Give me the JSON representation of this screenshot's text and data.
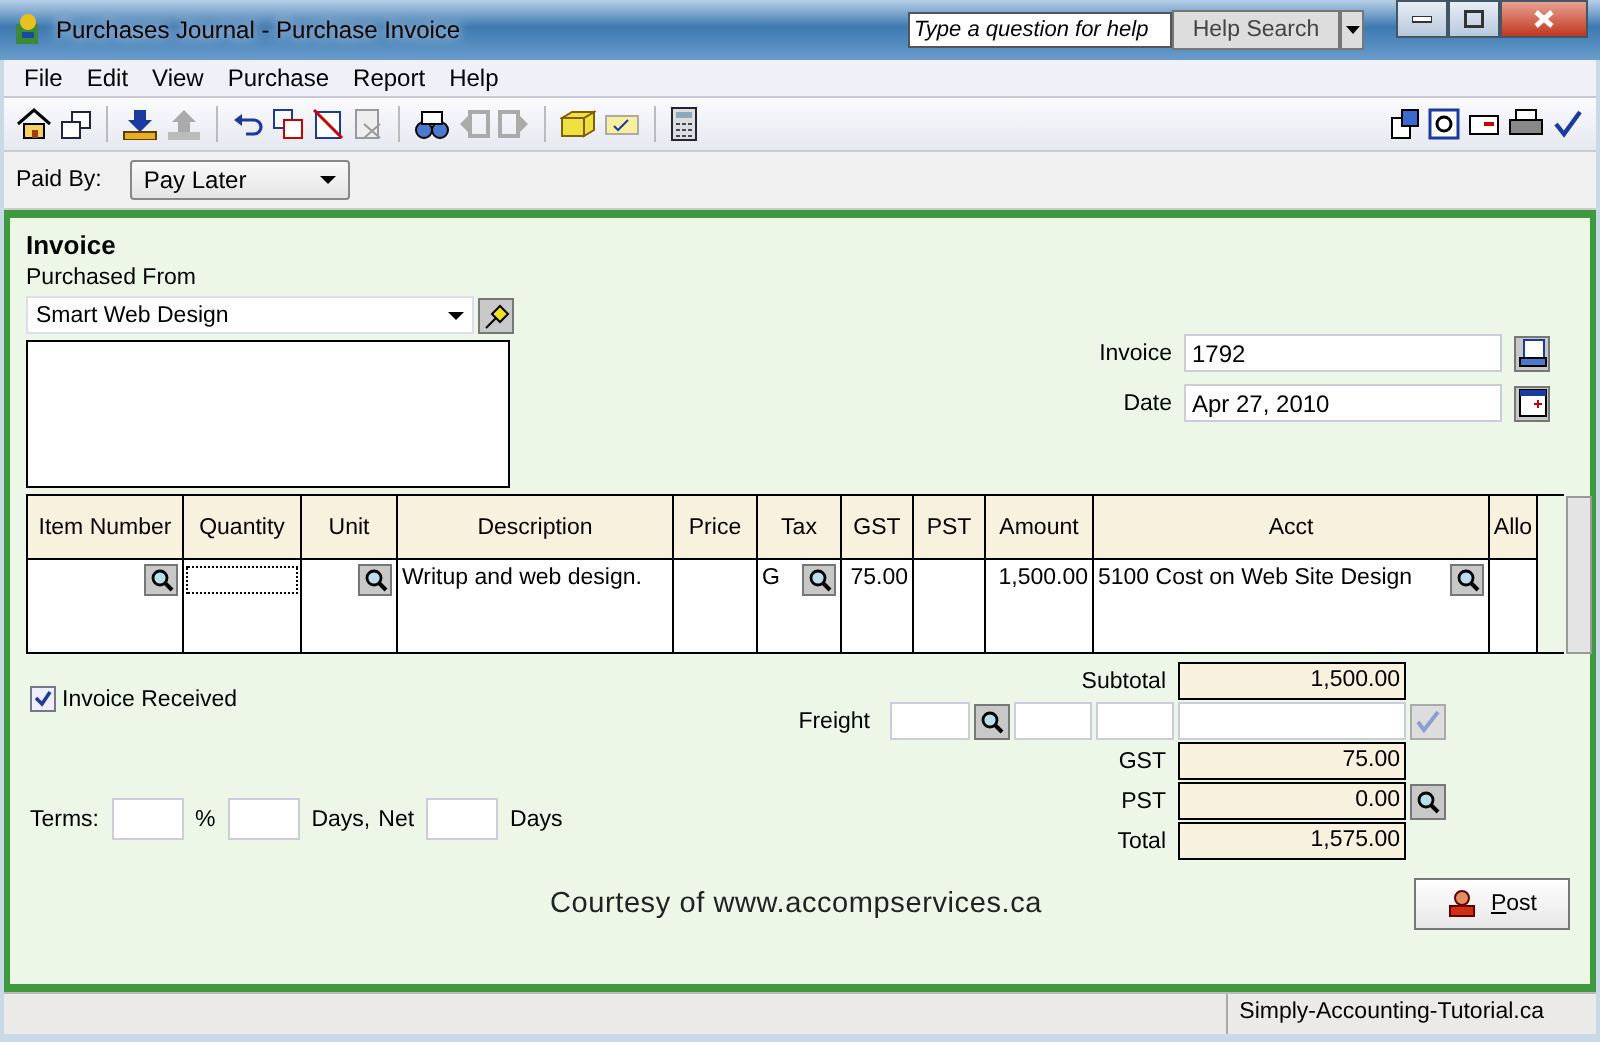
{
  "window": {
    "title": "Purchases Journal - Purchase Invoice",
    "help_placeholder": "Type a question for help",
    "help_button": "Help Search"
  },
  "menu": [
    "File",
    "Edit",
    "View",
    "Purchase",
    "Report",
    "Help"
  ],
  "paid_by": {
    "label": "Paid By:",
    "value": "Pay Later"
  },
  "invoice": {
    "heading": "Invoice",
    "vendor_label": "Purchased From",
    "vendor": "Smart Web Design",
    "number_label": "Invoice",
    "number": "1792",
    "date_label": "Date",
    "date": "Apr 27, 2010"
  },
  "table": {
    "columns": [
      {
        "label": "Item Number",
        "lookup": true,
        "focused": false
      },
      {
        "label": "Quantity",
        "lookup": false,
        "focused": true
      },
      {
        "label": "Unit",
        "lookup": true,
        "focused": false
      },
      {
        "label": "Description",
        "lookup": false,
        "focused": false
      },
      {
        "label": "Price",
        "lookup": false,
        "focused": false
      },
      {
        "label": "Tax",
        "lookup": true,
        "focused": false
      },
      {
        "label": "GST",
        "lookup": false,
        "focused": false
      },
      {
        "label": "PST",
        "lookup": false,
        "focused": false
      },
      {
        "label": "Amount",
        "lookup": false,
        "focused": false
      },
      {
        "label": "Acct",
        "lookup": true,
        "focused": false
      },
      {
        "label": "Allo",
        "lookup": false,
        "focused": false
      }
    ],
    "rows": [
      {
        "cells": [
          null,
          null,
          null,
          "Writup and web design.",
          null,
          "G",
          "75.00",
          null,
          "1,500.00",
          "5100 Cost on Web Site Design",
          null
        ]
      }
    ]
  },
  "invoice_received": {
    "label": "Invoice Received",
    "checked": true
  },
  "terms": {
    "label": "Terms:",
    "percent_sign": "%",
    "days_label": "Days,",
    "net_label": "Net",
    "net_days_label": "Days"
  },
  "totals": {
    "subtotal_label": "Subtotal",
    "subtotal": "1,500.00",
    "freight_label": "Freight",
    "gst_label": "GST",
    "gst": "75.00",
    "pst_label": "PST",
    "pst": "0.00",
    "total_label": "Total",
    "total": "1,575.00"
  },
  "courtesy": "Courtesy of www.accompservices.ca",
  "post_button": "Post",
  "status_bar": "Simply-Accounting-Tutorial.ca"
}
